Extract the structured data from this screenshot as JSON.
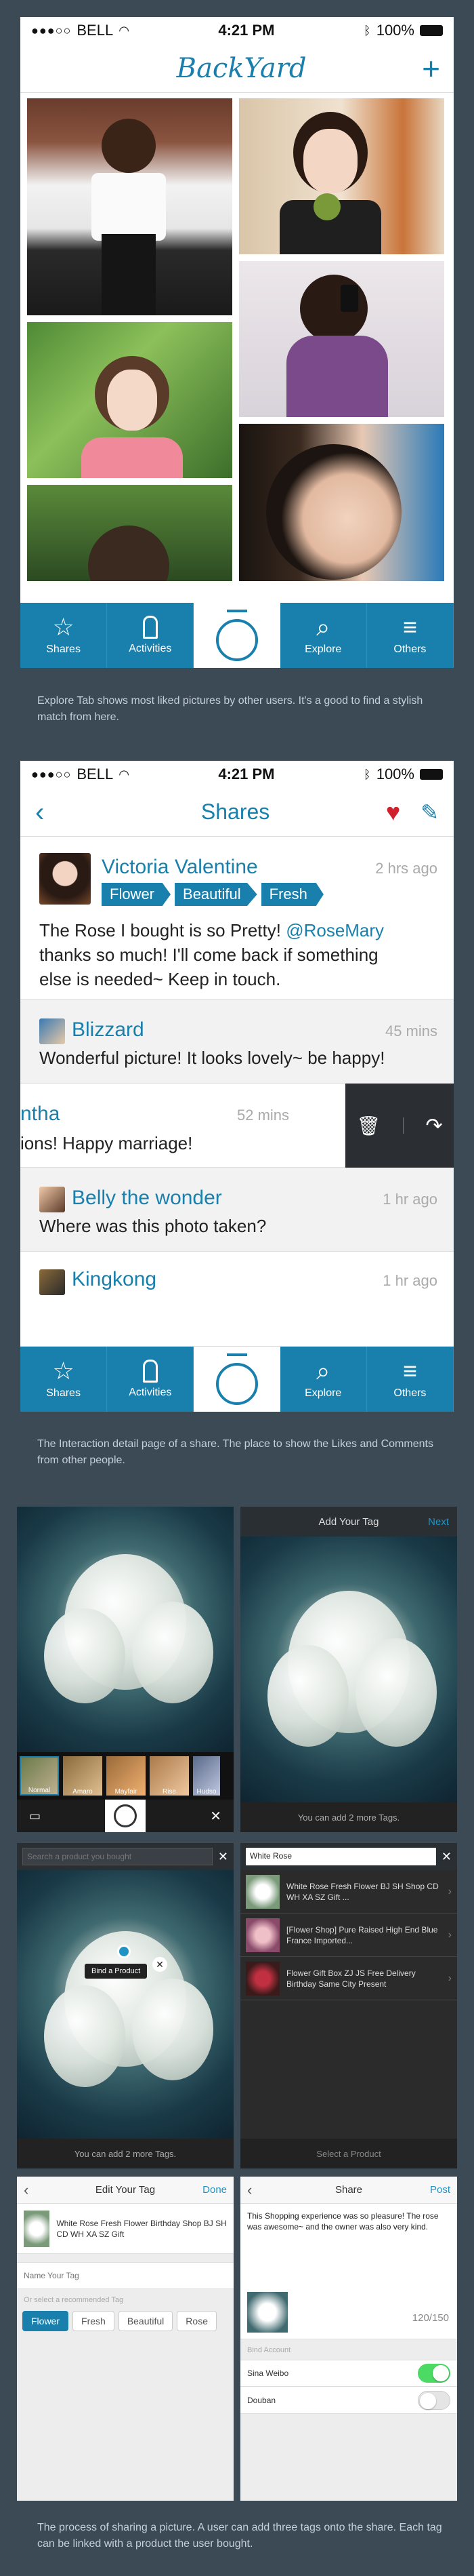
{
  "status": {
    "carrier": "BELL",
    "time": "4:21 PM",
    "battery": "100%"
  },
  "screen1": {
    "brand": "BackYard",
    "plus": "+",
    "caption": "Explore Tab shows most liked pictures by other users. It's a good to find a stylish match from here."
  },
  "tabbar": {
    "items": [
      {
        "label": "Shares",
        "icon": "star-icon"
      },
      {
        "label": "Activities",
        "icon": "tag-icon"
      },
      {
        "label": "",
        "icon": "camera-circle-icon"
      },
      {
        "label": "Explore",
        "icon": "search-icon"
      },
      {
        "label": "Others",
        "icon": "menu-icon"
      }
    ]
  },
  "screen2": {
    "title": "Shares",
    "caption": "The Interaction detail page of a share. The place to show the Likes and Comments from other people.",
    "cards": [
      {
        "name": "Victoria Valentine",
        "time": "2 hrs ago",
        "tags": [
          "Flower",
          "Beautiful",
          "Fresh"
        ],
        "text1": "The Rose I bought is so Pretty! ",
        "mention": "@RoseMary",
        "text2": "thanks so much! I'll come back if something",
        "text3": "else is needed~ Keep in touch."
      },
      {
        "name": "Blizzard",
        "time": "45 mins",
        "text": "Wonderful picture! It looks lovely~ be happy!"
      },
      {
        "name": "ntha",
        "time": "52 mins",
        "text": "ions! Happy marriage!"
      },
      {
        "name": "Belly the wonder",
        "time": "1 hr ago",
        "text": "Where was this photo taken?"
      },
      {
        "name": "Kingkong",
        "time": "1 hr ago"
      }
    ]
  },
  "screen3": {
    "add_tag_title": "Add Your Tag",
    "next": "Next",
    "filters": [
      "Normal",
      "Amaro",
      "Mayfair",
      "Rise",
      "Hudso"
    ],
    "can_add": "You can add 2 more Tags.",
    "search_placeholder": "Search a product you bought",
    "bind_product": "Bind a Product",
    "can_add2": "You can add 2 more Tags.",
    "search_value": "White Rose",
    "products": [
      {
        "title": "White Rose Fresh Flower BJ SH Shop CD WH XA SZ Gift ..."
      },
      {
        "title": "[Flower Shop] Pure Raised High End Blue France Imported..."
      },
      {
        "title": "Flower Gift Box ZJ JS Free Delivery Birthday Same City Present"
      }
    ],
    "select_product": "Select a Product",
    "edit_title": "Edit Your Tag",
    "done": "Done",
    "edit_product": "White Rose Fresh Flower Birthday Shop BJ SH CD WH XA SZ Gift",
    "name_placeholder": "Name Your Tag",
    "or_select": "Or select a recommended Tag",
    "rec_tags": [
      "Flower",
      "Fresh",
      "Beautiful",
      "Rose"
    ],
    "share_title": "Share",
    "post": "Post",
    "share_text": "This Shopping experience was so pleasure! The rose was awesome~ and the owner was also very kind.",
    "count": "120/150",
    "bind_account": "Bind Account",
    "accounts": [
      {
        "name": "Sina Weibo",
        "on": true
      },
      {
        "name": "Douban",
        "on": false
      }
    ],
    "caption": "The process of sharing a picture. A user can add three tags onto the share. Each tag can be linked with a product the user bought."
  },
  "colors": {
    "accent": "#1980ad",
    "background": "#3b4a55",
    "like": "#d0202e",
    "toggle_on": "#4cd964"
  }
}
